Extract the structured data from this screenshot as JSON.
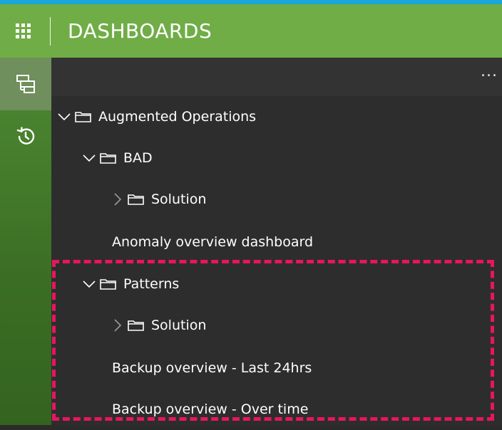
{
  "header": {
    "title": "DASHBOARDS",
    "waffle_icon": "waffle-icon"
  },
  "rail": {
    "items": [
      {
        "icon": "dashboard-tree-icon",
        "active": true
      },
      {
        "icon": "history-icon",
        "active": false
      }
    ]
  },
  "panel": {
    "more_label": "...",
    "tree": [
      {
        "label": "Augmented Operations",
        "type": "folder",
        "expanded": true
      },
      {
        "label": "BAD",
        "type": "folder",
        "expanded": true
      },
      {
        "label": "Solution",
        "type": "folder",
        "expanded": false
      },
      {
        "label": "Anomaly overview dashboard",
        "type": "dashboard"
      },
      {
        "label": "Patterns",
        "type": "folder",
        "expanded": true
      },
      {
        "label": "Solution",
        "type": "folder",
        "expanded": false
      },
      {
        "label": "Backup overview - Last 24hrs",
        "type": "dashboard"
      },
      {
        "label": "Backup overview - Over time",
        "type": "dashboard"
      }
    ]
  },
  "colors": {
    "header": "#70ad47",
    "rail": "#3b6e24",
    "panel": "#2d2d2d",
    "highlight": "#e8155f"
  }
}
